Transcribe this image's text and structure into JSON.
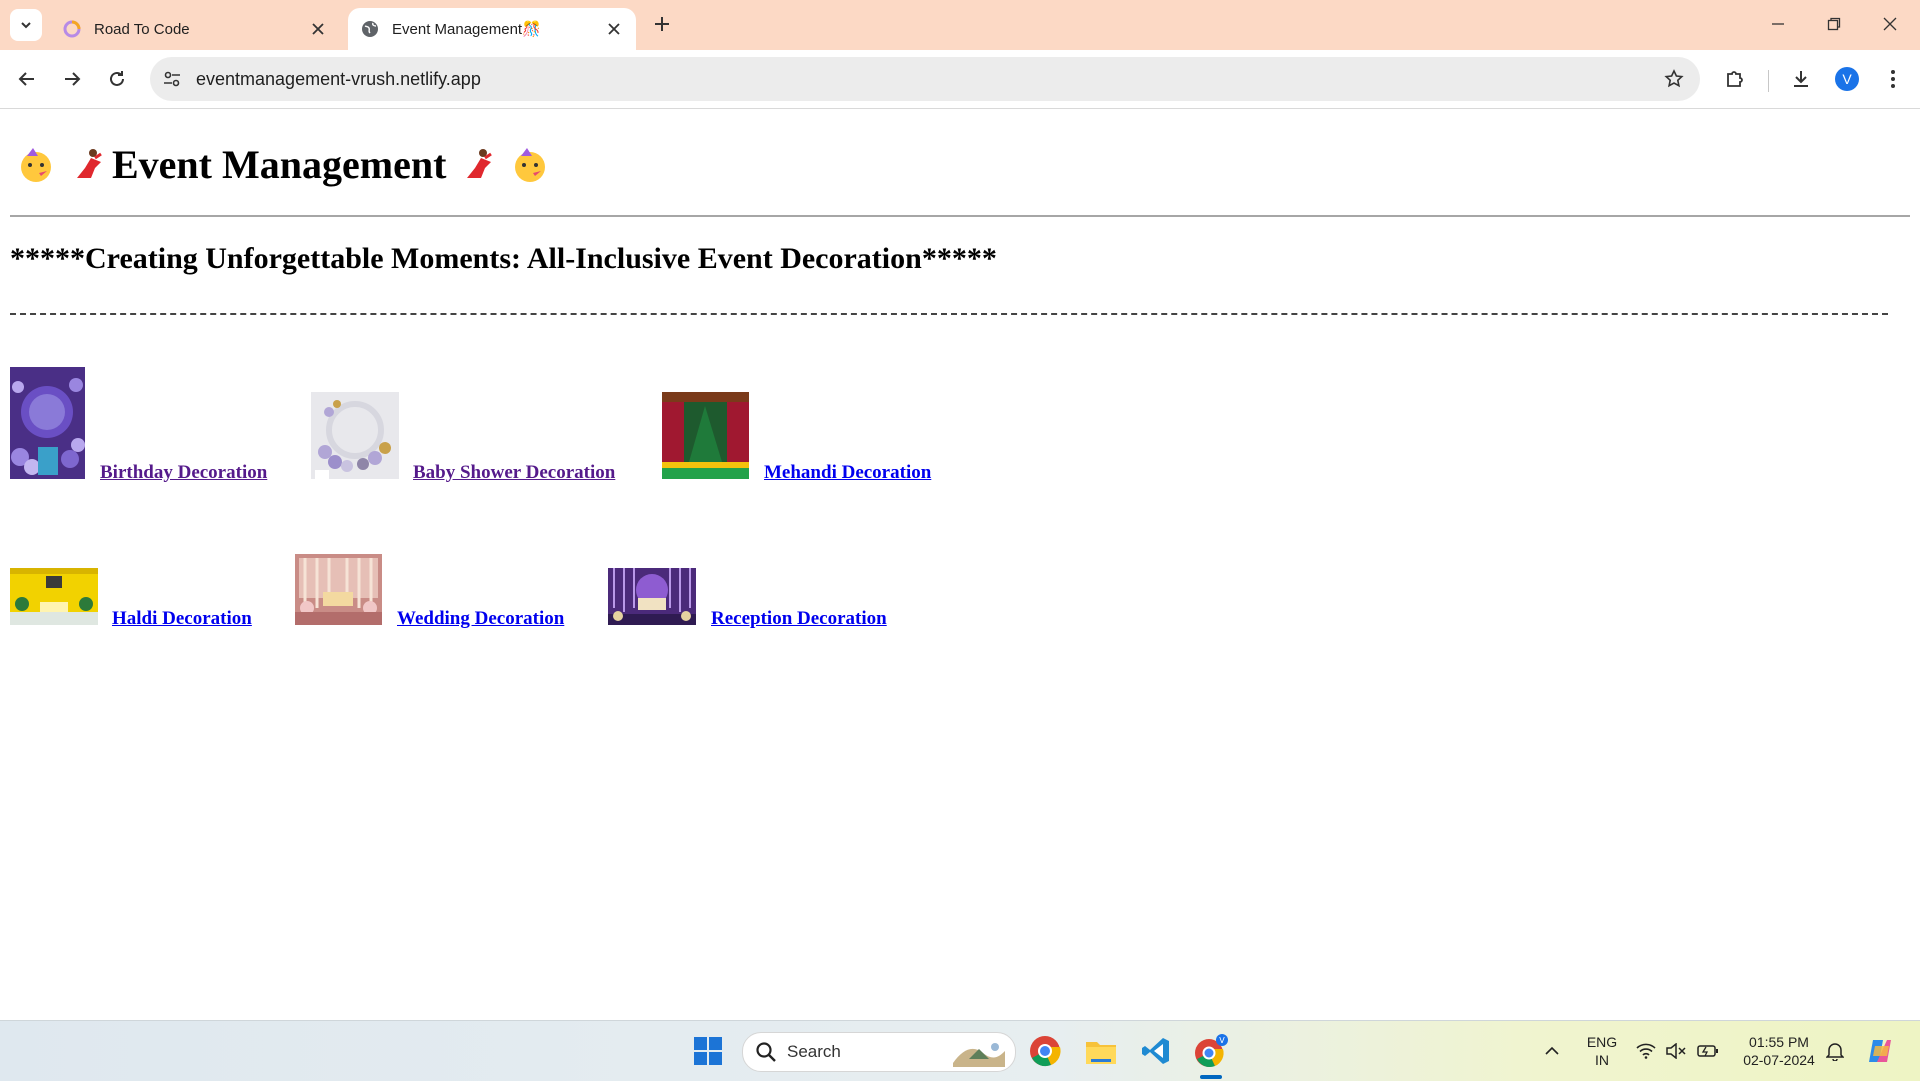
{
  "browser": {
    "tabs": [
      {
        "title": "Road To Code",
        "active": false
      },
      {
        "title": "Event Management🎊",
        "active": true
      }
    ],
    "url": "eventmanagement-vrush.netlify.app",
    "profile_initial": "V"
  },
  "page": {
    "title": "Event Management",
    "title_emojis": [
      "🥳",
      "💃"
    ],
    "subtitle": "*****Creating Unforgettable Moments: All-Inclusive Event Decoration*****",
    "links": [
      {
        "label": "Birthday Decoration",
        "visited": true
      },
      {
        "label": "Baby Shower Decoration",
        "visited": true
      },
      {
        "label": "Mehandi Decoration",
        "visited": false
      },
      {
        "label": "Haldi Decoration",
        "visited": false
      },
      {
        "label": "Wedding Decoration",
        "visited": false
      },
      {
        "label": "Reception Decoration",
        "visited": false
      }
    ]
  },
  "taskbar": {
    "search_placeholder": "Search",
    "language": "ENG",
    "region": "IN",
    "time": "01:55 PM",
    "date": "02-07-2024",
    "pinned_icons": [
      "windows-start-icon",
      "chrome-icon",
      "file-explorer-icon",
      "vscode-icon",
      "chrome-profile-icon"
    ]
  },
  "colors": {
    "tabbar": "#fcd9c5",
    "link_visited": "#551a8b",
    "link_unvisited": "#0000ee"
  }
}
